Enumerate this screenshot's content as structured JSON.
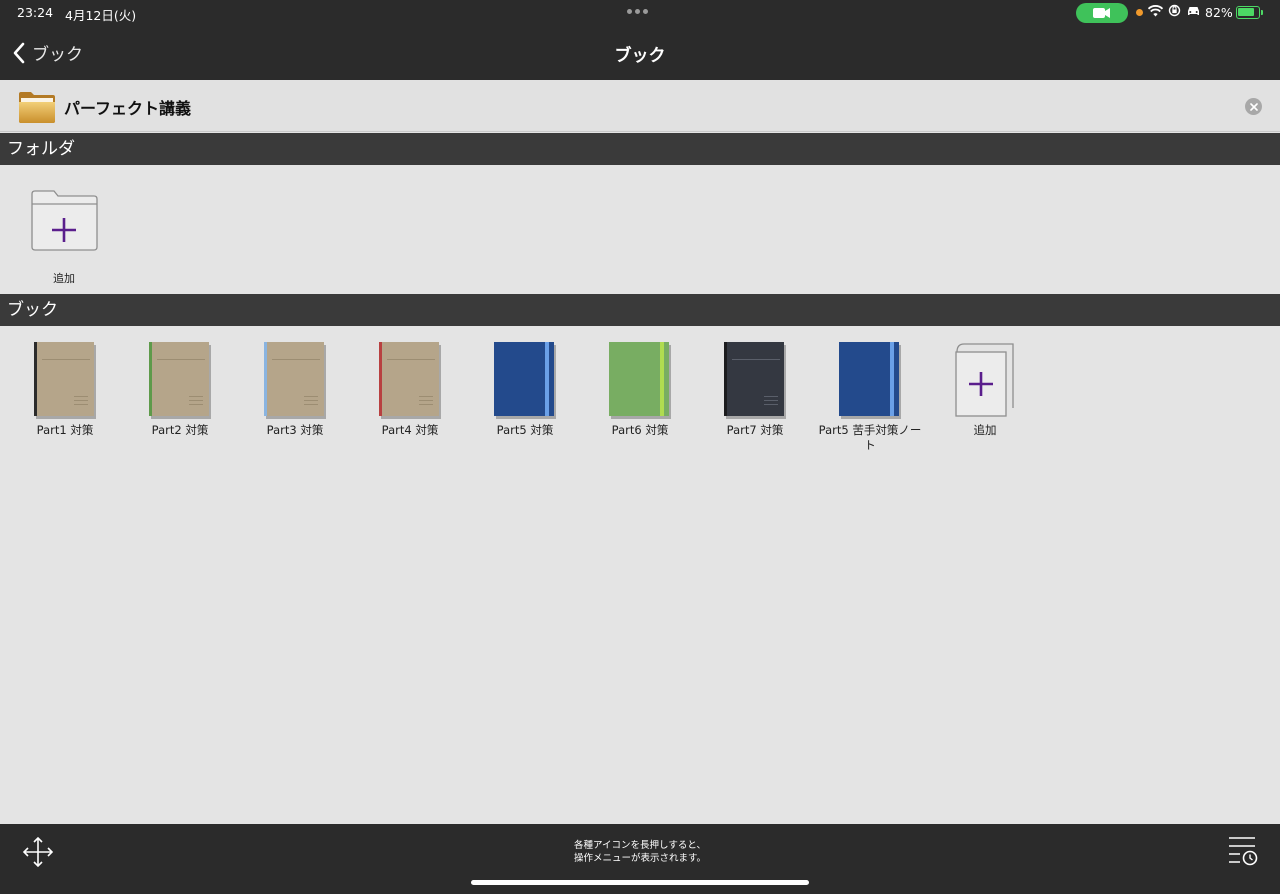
{
  "status": {
    "time": "23:24",
    "date": "4月12日(火)",
    "battery": "82%",
    "battery_level": 0.82
  },
  "nav": {
    "back_label": "ブック",
    "title": "ブック"
  },
  "folder_header": {
    "title": "パーフェクト講義"
  },
  "sections": {
    "folder": "フォルダ",
    "books": "ブック"
  },
  "folder_add": {
    "label": "追加"
  },
  "books": [
    {
      "label": "Part1 対策",
      "cover": "#b5a58a",
      "spine": "#2b2b2b",
      "style": "kraft"
    },
    {
      "label": "Part2 対策",
      "cover": "#b5a58a",
      "spine": "#5e9a4a",
      "style": "kraft"
    },
    {
      "label": "Part3 対策",
      "cover": "#b5a58a",
      "spine": "#8ab4e0",
      "style": "kraft"
    },
    {
      "label": "Part4 対策",
      "cover": "#b5a58a",
      "spine": "#b84040",
      "style": "kraft"
    },
    {
      "label": "Part5 対策",
      "cover": "#234a8c",
      "spine": "#6aa0e8",
      "style": "solid"
    },
    {
      "label": "Part6 対策",
      "cover": "#78ad62",
      "spine": "#b0dc50",
      "style": "solid"
    },
    {
      "label": "Part7 対策",
      "cover": "#343841",
      "spine": "#1c1c1e",
      "style": "dark"
    },
    {
      "label": "Part5 苦手対策ノート",
      "cover": "#234a8c",
      "spine": "#6aa0e8",
      "style": "solid"
    }
  ],
  "book_add": {
    "label": "追加"
  },
  "toolbar": {
    "hint_line1": "各種アイコンを長押しすると、",
    "hint_line2": "操作メニューが表示されます。"
  }
}
